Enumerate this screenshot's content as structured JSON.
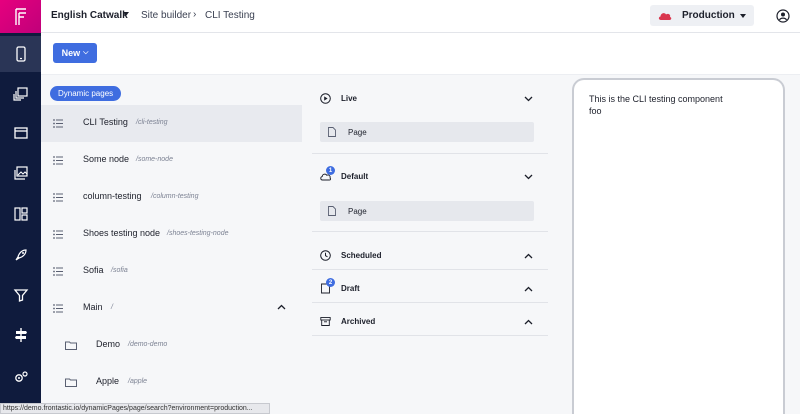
{
  "rail": {
    "logo_letter": "F",
    "items": [
      {
        "icon": "mobile-icon",
        "active": true
      },
      {
        "icon": "layers-icon",
        "active": false
      },
      {
        "icon": "window-icon",
        "active": false
      },
      {
        "icon": "images-icon",
        "active": false
      },
      {
        "icon": "dashboard-icon",
        "active": false
      },
      {
        "icon": "rocket-icon",
        "active": false
      },
      {
        "icon": "filter-icon",
        "active": false
      },
      {
        "icon": "signpost-icon",
        "active": false
      },
      {
        "icon": "settings-gears-icon",
        "active": false
      }
    ]
  },
  "header": {
    "project": "English Catwalk",
    "breadcrumb_site": "Site builder",
    "breadcrumb_sep": "›",
    "breadcrumb_page": "CLI Testing",
    "environment": "Production",
    "environment_color": "#d9364e"
  },
  "actions": {
    "new_label": "New"
  },
  "tree": {
    "pill_label": "Dynamic pages",
    "rows": [
      {
        "name": "CLI Testing",
        "path": "/cli-testing",
        "kind": "page",
        "selected": true
      },
      {
        "name": "Some node",
        "path": "/some-node",
        "kind": "page",
        "selected": false
      },
      {
        "name": "column-testing",
        "path": "/column-testing",
        "kind": "page",
        "selected": false
      },
      {
        "name": "Shoes testing node",
        "path": "/shoes-testing-node",
        "kind": "page",
        "selected": false
      },
      {
        "name": "Sofia",
        "path": "/sofia",
        "kind": "page",
        "selected": false
      },
      {
        "name": "Main",
        "path": "/",
        "kind": "page",
        "selected": false
      },
      {
        "name": "Demo",
        "path": "/demo-demo",
        "kind": "folder",
        "selected": false
      },
      {
        "name": "Apple",
        "path": "/apple",
        "kind": "folder",
        "selected": false
      }
    ]
  },
  "versions": {
    "sections": [
      {
        "title": "Live",
        "icon": "play-circle-icon",
        "badge": "",
        "cards": [
          "Page"
        ],
        "expanded": true
      },
      {
        "title": "Default",
        "icon": "cloud-icon",
        "badge": "1",
        "cards": [
          "Page"
        ],
        "expanded": true
      },
      {
        "title": "Scheduled",
        "icon": "clock-icon",
        "badge": "",
        "cards": [],
        "expanded": false
      },
      {
        "title": "Draft",
        "icon": "draft-doc-icon",
        "badge": "2",
        "cards": [],
        "expanded": false
      },
      {
        "title": "Archived",
        "icon": "archive-box-icon",
        "badge": "",
        "cards": [],
        "expanded": false
      }
    ]
  },
  "preview": {
    "line1": "This is the CLI testing component",
    "line2": "foo"
  },
  "status": {
    "url": "https://demo.frontastic.io/dynamicPages/page/search?environment=production..."
  },
  "colors": {
    "accent": "#3f6de0",
    "rail": "#0f1b3d",
    "logo": "#e6007e"
  }
}
